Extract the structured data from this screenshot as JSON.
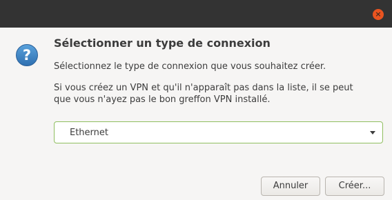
{
  "window": {
    "close_glyph": "×"
  },
  "dialog": {
    "icon": "question-icon",
    "heading": "Sélectionner un type de connexion",
    "subtext": "Sélectionnez le type de connexion que vous souhaitez créer.",
    "info_lines": [
      "Si vous créez un VPN et qu'il n'apparaît pas dans la liste, il se peut",
      "que vous n'ayez pas le bon greffon VPN installé."
    ]
  },
  "connection_type": {
    "selected": "Ethernet"
  },
  "buttons": {
    "cancel": "Annuler",
    "create": "Créer..."
  },
  "colors": {
    "titlebar": "#333333",
    "close_button": "#e95420",
    "icon_blue": "#3d86c6",
    "combo_focus_border": "#8fbe5f"
  }
}
